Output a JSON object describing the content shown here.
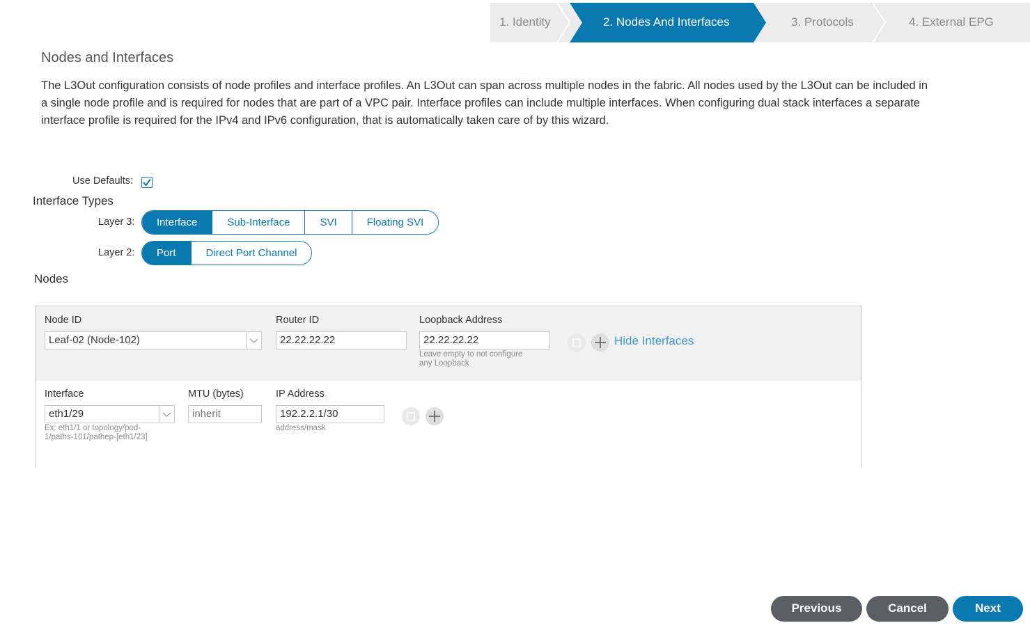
{
  "wizard": {
    "steps": [
      "1. Identity",
      "2. Nodes And Interfaces",
      "3. Protocols",
      "4. External EPG"
    ],
    "active_step": 2
  },
  "page": {
    "title": "Nodes and Interfaces",
    "description_lines": [
      "The L3Out configuration consists of node profiles and interface profiles. An L3Out can span across multiple nodes in the fabric. All nodes used by the L3Out can be included in",
      "a single node profile and is required for nodes that are part of a VPC pair. Interface profiles can include multiple interfaces. When configuring dual stack interfaces a separate",
      "interface profile is required for the IPv4 and IPv6 configuration, that is automatically taken care of by this wizard."
    ]
  },
  "use_defaults": {
    "label": "Use Defaults:",
    "checked": true
  },
  "interface_types": {
    "title": "Interface Types",
    "layer3": {
      "label": "Layer 3:",
      "options": [
        "Interface",
        "Sub-Interface",
        "SVI",
        "Floating SVI"
      ],
      "selected": "Interface"
    },
    "layer2": {
      "label": "Layer 2:",
      "options": [
        "Port",
        "Direct Port Channel"
      ],
      "selected": "Port"
    }
  },
  "nodes": {
    "title": "Nodes",
    "node": {
      "node_id_label": "Node ID",
      "node_id_value": "Leaf-02 (Node-102)",
      "router_id_label": "Router ID",
      "router_id_value": "22.22.22.22",
      "loopback_label": "Loopback Address",
      "loopback_value": "22.22.22.22",
      "loopback_hint_1": "Leave empty to not configure",
      "loopback_hint_2": "any Loopback",
      "hide_interfaces": "Hide Interfaces"
    },
    "interface": {
      "interface_label": "Interface",
      "interface_value": "eth1/29",
      "interface_hint_1": "Ex: eth1/1 or topology/pod-",
      "interface_hint_2": "1/paths-101/pathep-[eth1/23]",
      "mtu_label": "MTU (bytes)",
      "mtu_value": "inherit",
      "ip_label": "IP Address",
      "ip_value": "192.2.2.1/30",
      "ip_hint": "address/mask"
    }
  },
  "footer": {
    "previous": "Previous",
    "cancel": "Cancel",
    "next": "Next"
  },
  "colors": {
    "accent": "#0a79b0",
    "dark_button": "#5b5f63",
    "link": "#3d9ad6"
  }
}
